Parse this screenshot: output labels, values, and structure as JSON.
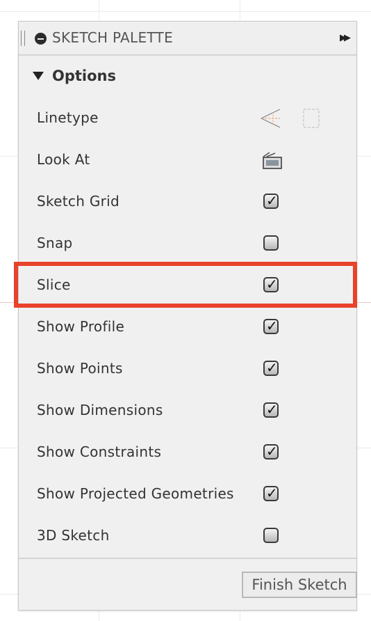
{
  "palette": {
    "title": "SKETCH PALETTE",
    "section": "Options",
    "rows": [
      {
        "label": "Linetype",
        "control": "icons",
        "icons": [
          "construction-linetype-icon",
          "centerline-linetype-icon"
        ]
      },
      {
        "label": "Look At",
        "control": "icon",
        "icons": [
          "look-at-icon"
        ]
      },
      {
        "label": "Sketch Grid",
        "control": "checkbox",
        "checked": true
      },
      {
        "label": "Snap",
        "control": "checkbox",
        "checked": false
      },
      {
        "label": "Slice",
        "control": "checkbox",
        "checked": true,
        "highlighted": true
      },
      {
        "label": "Show Profile",
        "control": "checkbox",
        "checked": true
      },
      {
        "label": "Show Points",
        "control": "checkbox",
        "checked": true
      },
      {
        "label": "Show Dimensions",
        "control": "checkbox",
        "checked": true
      },
      {
        "label": "Show Constraints",
        "control": "checkbox",
        "checked": true
      },
      {
        "label": "Show Projected Geometries",
        "control": "checkbox",
        "checked": true
      },
      {
        "label": "3D Sketch",
        "control": "checkbox",
        "checked": false
      }
    ],
    "finish_label": "Finish Sketch",
    "highlight_color": "#e8432a",
    "check_glyph": "✓"
  }
}
